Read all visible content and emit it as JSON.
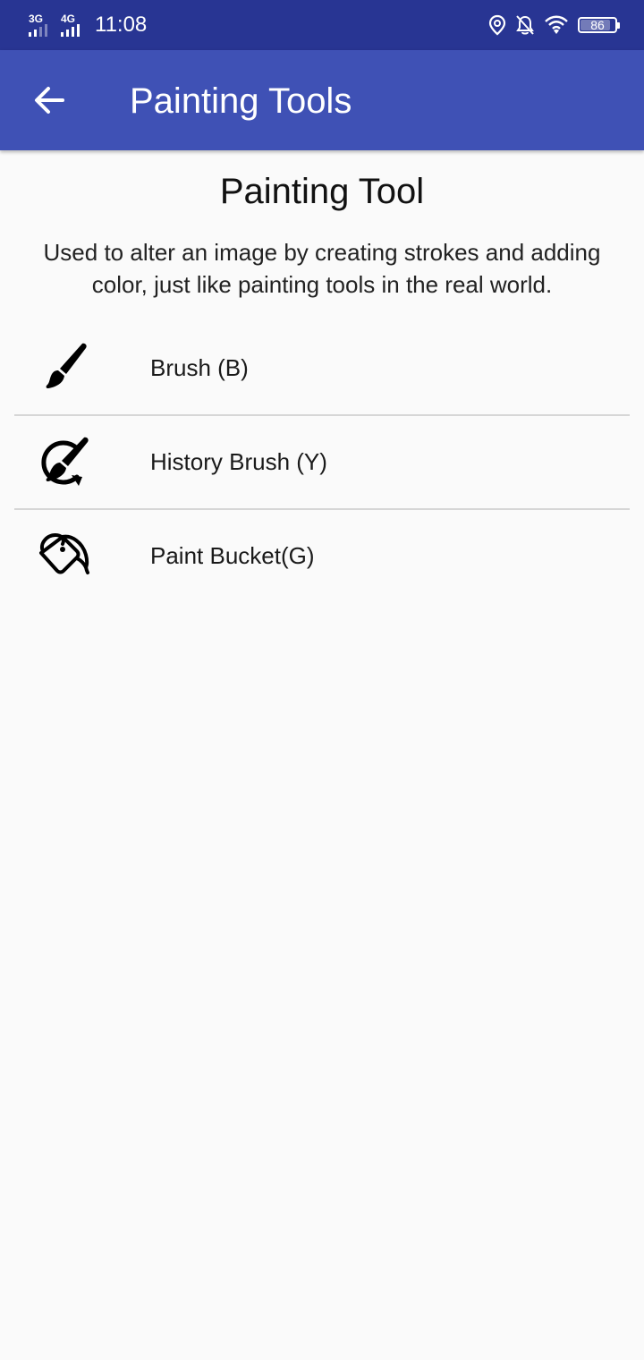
{
  "status_bar": {
    "network_1": "3G",
    "network_2": "4G",
    "time": "11:08",
    "battery_percent": "86",
    "battery_level": 0.86,
    "icons": [
      "location-icon",
      "notifications-off-icon",
      "wifi-icon",
      "battery-icon"
    ]
  },
  "app_bar": {
    "title": "Painting Tools",
    "back_icon": "arrow-back-icon",
    "color": "#3f51b5",
    "status_color": "#283593"
  },
  "section": {
    "title": "Painting Tool",
    "description": "Used to alter an image by creating strokes and adding color, just like painting tools in the real world."
  },
  "tools": [
    {
      "label": "Brush (B)",
      "icon": "brush-icon"
    },
    {
      "label": "History Brush (Y)",
      "icon": "history-brush-icon"
    },
    {
      "label": "Paint Bucket(G)",
      "icon": "paint-bucket-icon"
    }
  ]
}
